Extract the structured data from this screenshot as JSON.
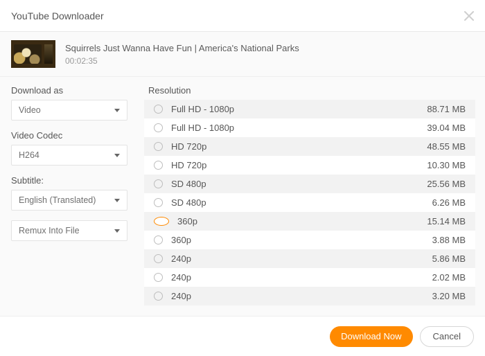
{
  "window": {
    "title": "YouTube Downloader"
  },
  "video": {
    "title": "Squirrels Just Wanna Have Fun | America's National Parks",
    "duration": "00:02:35"
  },
  "sidebar": {
    "download_as_label": "Download as",
    "download_as_value": "Video",
    "codec_label": "Video Codec",
    "codec_value": "H264",
    "subtitle_label": "Subtitle:",
    "subtitle_value": "English (Translated)",
    "remux_value": "Remux Into File"
  },
  "resolution": {
    "label": "Resolution",
    "selected_index": 6,
    "items": [
      {
        "label": "Full HD - 1080p",
        "size": "88.71 MB"
      },
      {
        "label": "Full HD - 1080p",
        "size": "39.04 MB"
      },
      {
        "label": "HD 720p",
        "size": "48.55 MB"
      },
      {
        "label": "HD 720p",
        "size": "10.30 MB"
      },
      {
        "label": "SD 480p",
        "size": "25.56 MB"
      },
      {
        "label": "SD 480p",
        "size": "6.26 MB"
      },
      {
        "label": "360p",
        "size": "15.14 MB"
      },
      {
        "label": "360p",
        "size": "3.88 MB"
      },
      {
        "label": "240p",
        "size": "5.86 MB"
      },
      {
        "label": "240p",
        "size": "2.02 MB"
      },
      {
        "label": "240p",
        "size": "3.20 MB"
      }
    ]
  },
  "footer": {
    "download_label": "Download Now",
    "cancel_label": "Cancel"
  }
}
